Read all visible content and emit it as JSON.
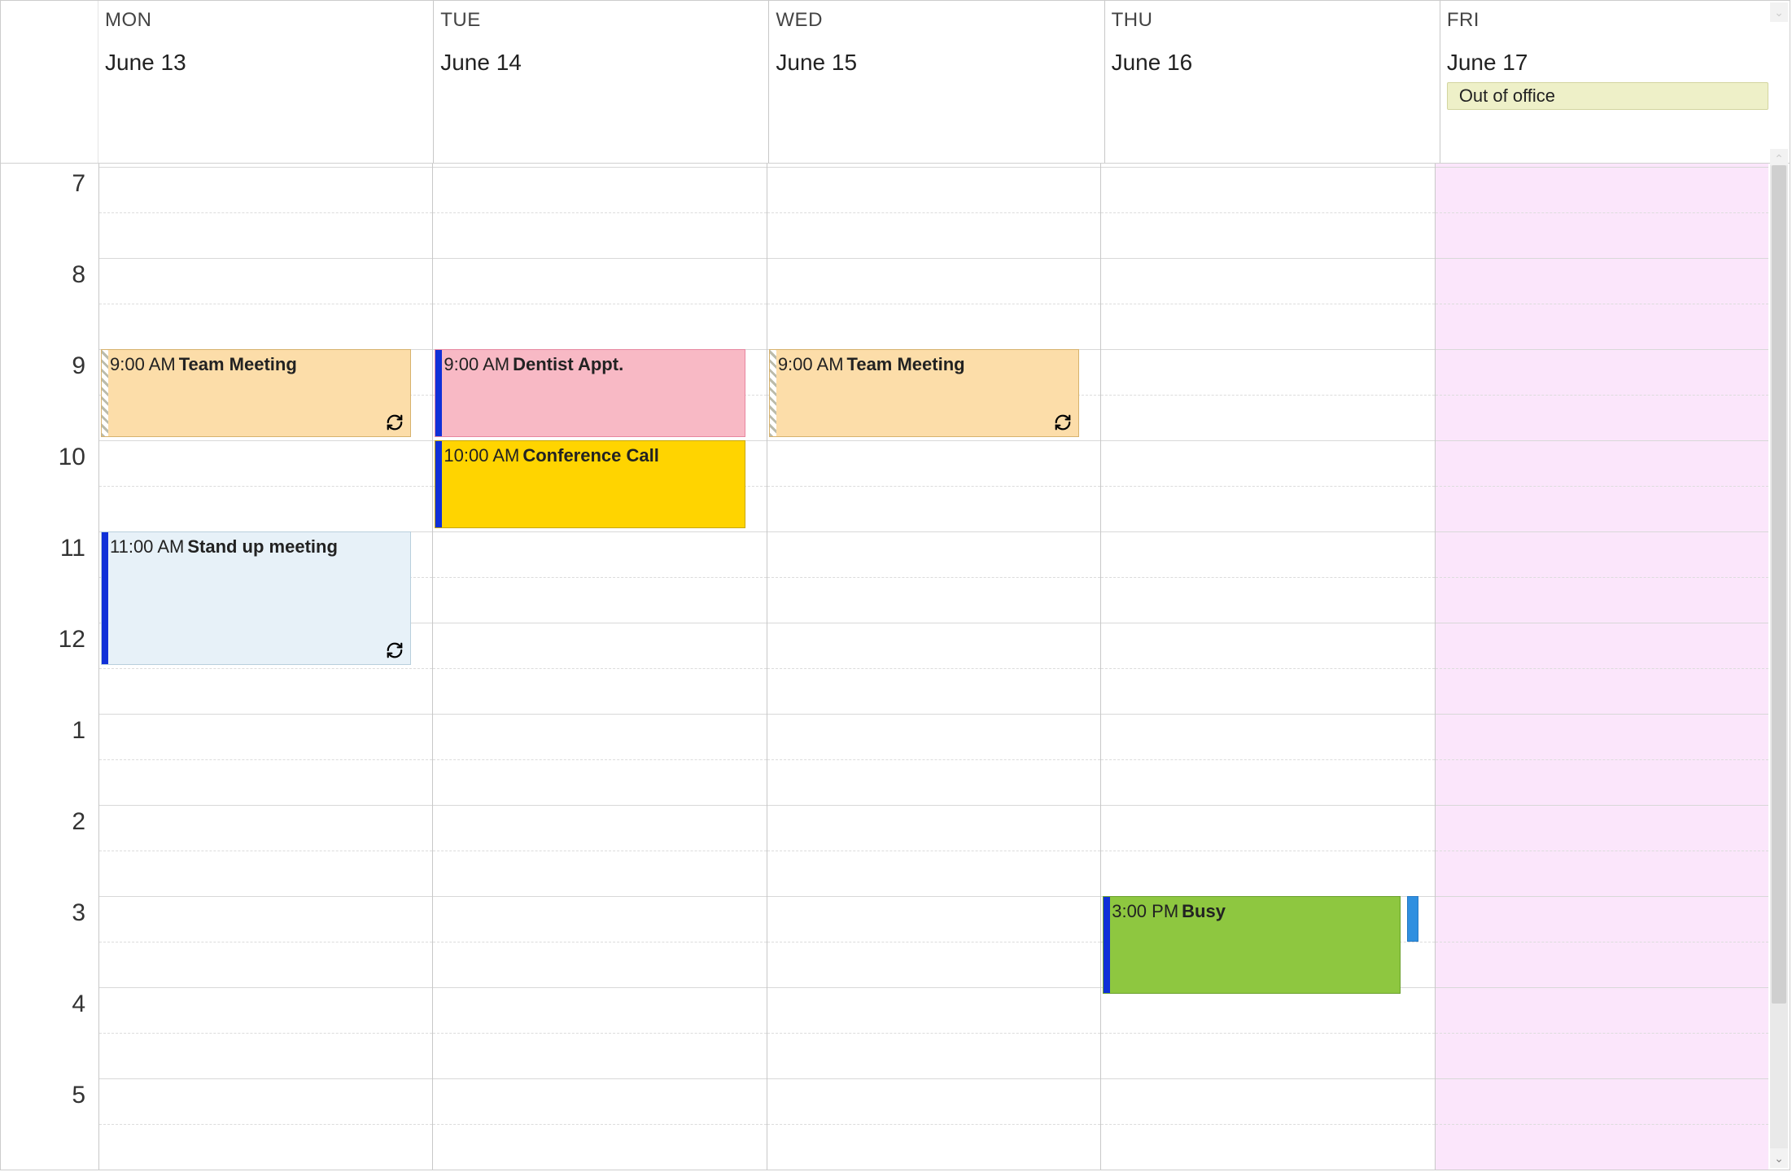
{
  "days": [
    {
      "dow": "MON",
      "date": "June 13"
    },
    {
      "dow": "TUE",
      "date": "June 14"
    },
    {
      "dow": "WED",
      "date": "June 15"
    },
    {
      "dow": "THU",
      "date": "June 16"
    },
    {
      "dow": "FRI",
      "date": "June 17",
      "allday": "Out of office"
    }
  ],
  "hours": [
    "7",
    "8",
    "9",
    "10",
    "11",
    "12",
    "1",
    "2",
    "3",
    "4",
    "5"
  ],
  "events": {
    "team_mon": {
      "time": "9:00 AM",
      "title": "Team Meeting"
    },
    "dentist": {
      "time": "9:00 AM",
      "title": "Dentist Appt."
    },
    "team_wed": {
      "time": "9:00 AM",
      "title": "Team Meeting"
    },
    "conf": {
      "time": "10:00 AM",
      "title": "Conference Call"
    },
    "standup": {
      "time": "11:00 AM",
      "title": "Stand up meeting"
    },
    "busy": {
      "time": "3:00 PM",
      "title": "Busy"
    }
  },
  "grid": {
    "hourHeight": 112,
    "startOffset": 4
  }
}
